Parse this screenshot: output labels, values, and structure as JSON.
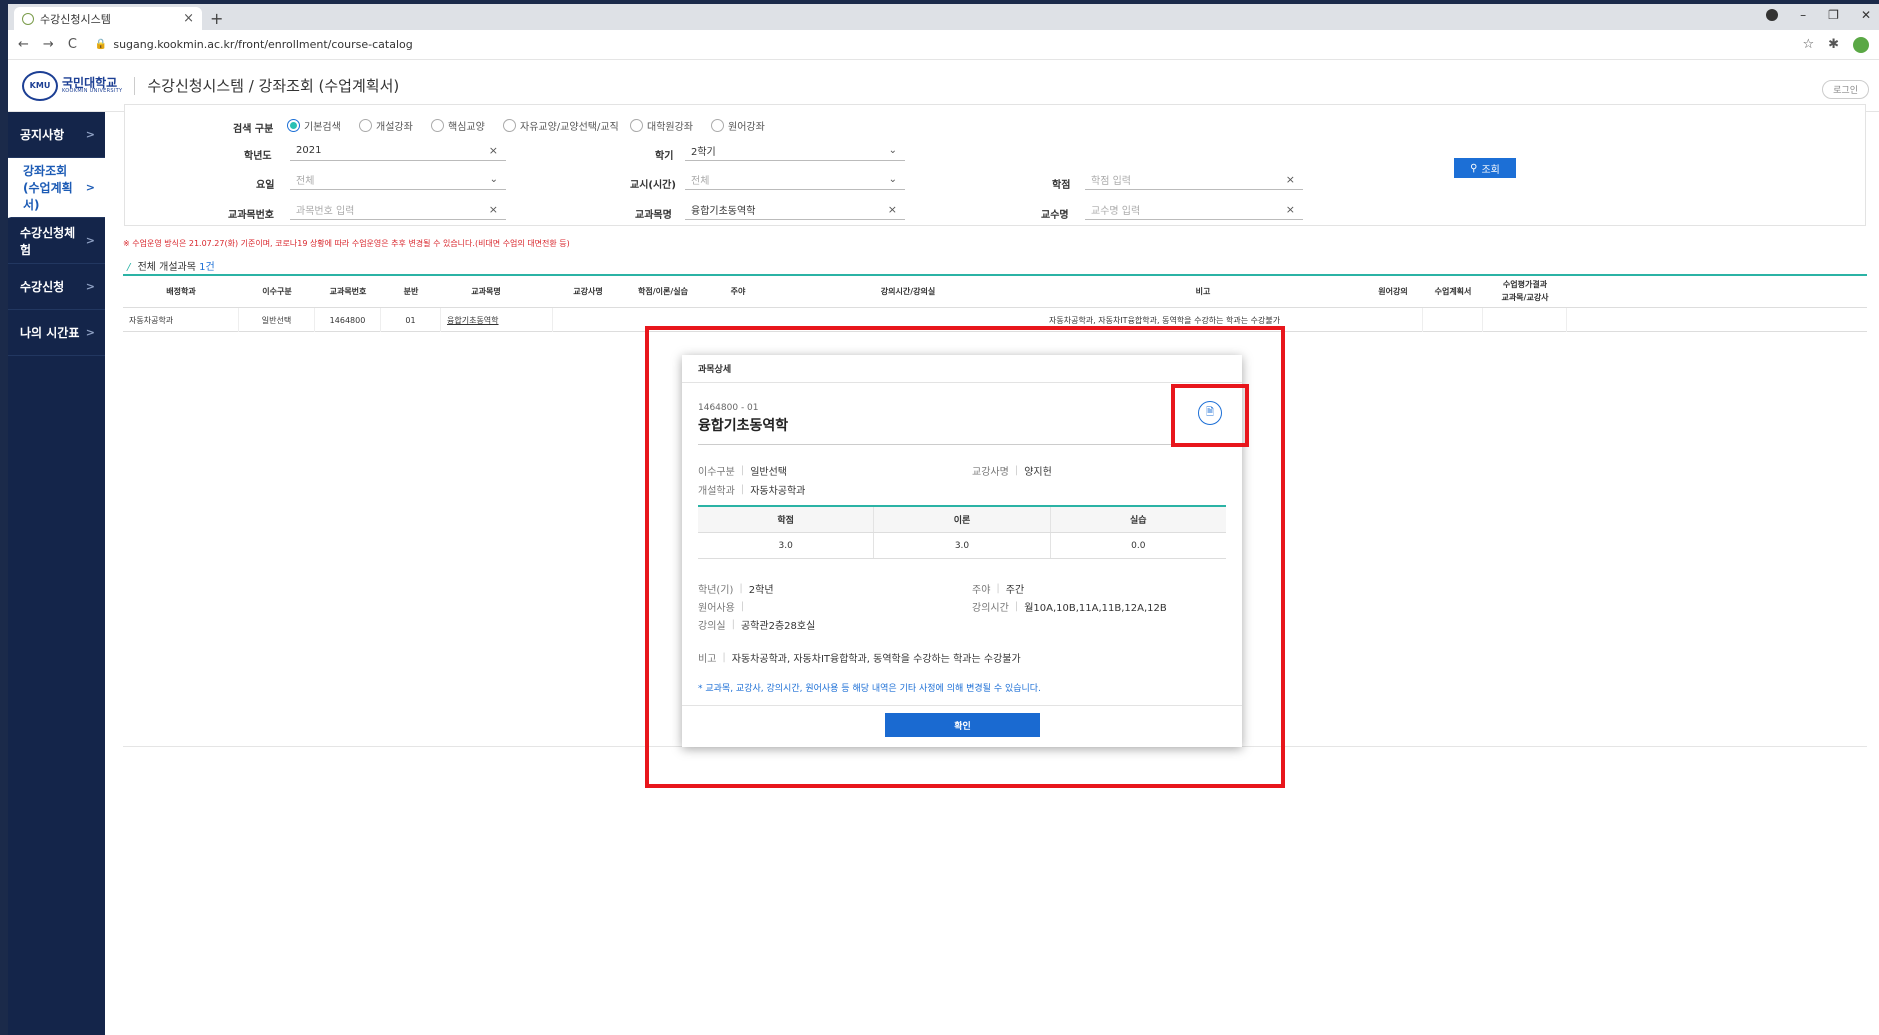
{
  "browser": {
    "tab_title": "수강신청시스템",
    "tab_close": "×",
    "new_tab": "+",
    "url": "sugang.kookmin.ac.kr/front/enrollment/course-catalog",
    "back": "←",
    "forward": "→",
    "reload": "C",
    "lock": "🔒",
    "star": "☆",
    "extensions": "✱",
    "minimize": "–",
    "restore": "❐",
    "close": "✕"
  },
  "header": {
    "logo_badge": "KMU",
    "logo_kr": "국민대학교",
    "logo_en": "KOOKMIN UNIVERSITY",
    "title": "수강신청시스템 / 강좌조회 (수업계획서)",
    "login_label": "로그인"
  },
  "sidebar": {
    "items": [
      {
        "label": "공지사항"
      },
      {
        "label": "강좌조회",
        "label2": "(수업계획서)"
      },
      {
        "label": "수강신청체험"
      },
      {
        "label": "수강신청"
      },
      {
        "label": "나의 시간표"
      }
    ],
    "arrow": ">"
  },
  "search": {
    "type_label": "검색 구분",
    "types": [
      "기본검색",
      "개설강좌",
      "핵심교양",
      "자유교양/교양선택/교직",
      "대학원강좌",
      "원어강좌"
    ],
    "year_label": "학년도",
    "year_value": "2021",
    "semester_label": "학기",
    "semester_value": "2학기",
    "day_label": "요일",
    "day_placeholder": "전체",
    "period_label": "교시(시간)",
    "period_placeholder": "전체",
    "credit_label": "학점",
    "credit_placeholder": "학점 입력",
    "course_no_label": "교과목번호",
    "course_no_placeholder": "과목번호 입력",
    "course_name_label": "교과목명",
    "course_name_value": "융합기초동역학",
    "professor_label": "교수명",
    "professor_placeholder": "교수명 입력",
    "search_button": "조회",
    "clear": "×",
    "caret": "⌄"
  },
  "notice": "※ 수업운영 방식은 21.07.27(화) 기준이며, 코로나19 상황에 따라 수업운영은 추후 변경될 수 있습니다.(비대면 수업의 대면전환 등)",
  "count": {
    "prefix": "전체 개설과목",
    "num": "1건"
  },
  "table": {
    "headers": [
      "배정학과",
      "이수구분",
      "교과목번호",
      "분반",
      "교과목명",
      "교강사명",
      "학점/이론/실습",
      "주야",
      "강의시간/강의실",
      "비고",
      "원어강의",
      "수업계획서",
      "수업평가결과",
      "교과목/교강사"
    ],
    "row": {
      "dept": "자동차공학과",
      "type": "일반선택",
      "code": "1464800",
      "section": "01",
      "name": "융합기초동역학",
      "remark": "자동차공학과, 자동차IT융합학과, 동역학을 수강하는 학과는 수강불가"
    }
  },
  "modal": {
    "header": "과목상세",
    "code": "1464800 - 01",
    "title": "융합기초동역학",
    "plan_icon": "🗎",
    "type_key": "이수구분",
    "type_val": "일반선택",
    "prof_key": "교강사명",
    "prof_val": "양지헌",
    "dept_key": "개설학과",
    "dept_val": "자동차공학과",
    "credit_headers": [
      "학점",
      "이론",
      "실습"
    ],
    "credit_values": [
      "3.0",
      "3.0",
      "0.0"
    ],
    "grade_key": "학년(기)",
    "grade_val": "2학년",
    "daynight_key": "주야",
    "daynight_val": "주간",
    "lang_key": "원어사용",
    "lang_val": "",
    "time_key": "강의시간",
    "time_val": "월10A,10B,11A,11B,12A,12B",
    "room_key": "강의실",
    "room_val": "공학관2층28호실",
    "remark_key": "비고",
    "remark_val": "자동차공학과, 자동차IT융합학과, 동역학을 수강하는 학과는 수강불가",
    "note": "* 교과목, 교강사, 강의시간, 원어사용 등 해당 내역은 기타 사정에 의해 변경될 수 있습니다.",
    "confirm": "확인"
  },
  "colors": {
    "accent": "#1c6fd6",
    "teal": "#2bb3a5",
    "sidebar": "#14254a",
    "highlight": "#e8161c"
  }
}
